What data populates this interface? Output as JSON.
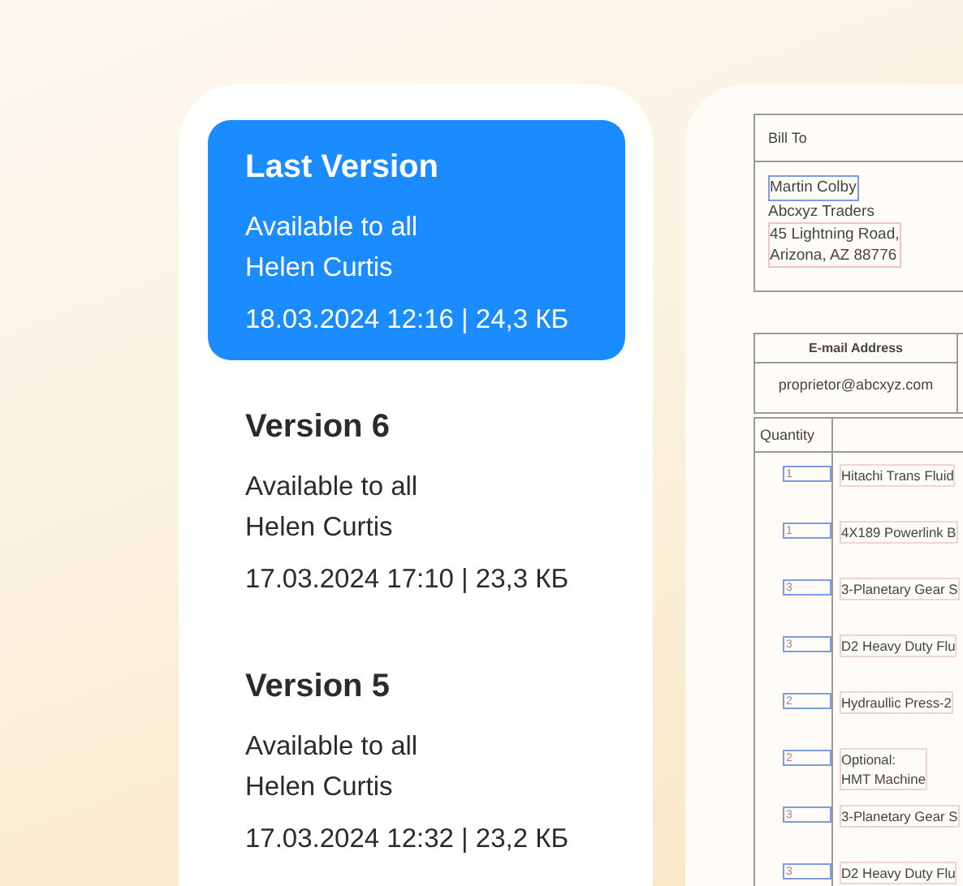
{
  "versions": [
    {
      "title": "Last Version",
      "access": "Available to all",
      "author": "Helen Curtis",
      "meta": "18.03.2024 12:16 | 24,3 КБ",
      "selected": true
    },
    {
      "title": "Version 6",
      "access": "Available to all",
      "author": "Helen Curtis",
      "meta": "17.03.2024 17:10 | 23,3 КБ",
      "selected": false
    },
    {
      "title": "Version 5",
      "access": "Available to all",
      "author": "Helen Curtis",
      "meta": "17.03.2024 12:32 | 23,2 КБ",
      "selected": false
    }
  ],
  "document": {
    "bill_to": {
      "label": "Bill To",
      "name": "Martin Colby",
      "company": "Abcxyz Traders",
      "address": [
        "45 Lightning Road,",
        "Arizona, AZ 88776"
      ]
    },
    "email": {
      "label": "E-mail Address",
      "value": "proprietor@abcxyz.com"
    },
    "items_table": {
      "quantity_label": "Quantity",
      "rows": [
        {
          "quantity": "1",
          "description": [
            "Hitachi Trans Fluid"
          ]
        },
        {
          "quantity": "1",
          "description": [
            "4X189 Powerlink B"
          ]
        },
        {
          "quantity": "3",
          "description": [
            "3-Planetary Gear S"
          ]
        },
        {
          "quantity": "3",
          "description": [
            "D2 Heavy Duty Flu"
          ]
        },
        {
          "quantity": "2",
          "description": [
            "Hydraullic Press-2"
          ]
        },
        {
          "quantity": "2",
          "description": [
            "Optional:",
            "HMT Machine"
          ]
        },
        {
          "quantity": "3",
          "description": [
            "3-Planetary Gear S"
          ]
        },
        {
          "quantity": "3",
          "description": [
            "D2 Heavy Duty Flu"
          ]
        }
      ]
    }
  }
}
